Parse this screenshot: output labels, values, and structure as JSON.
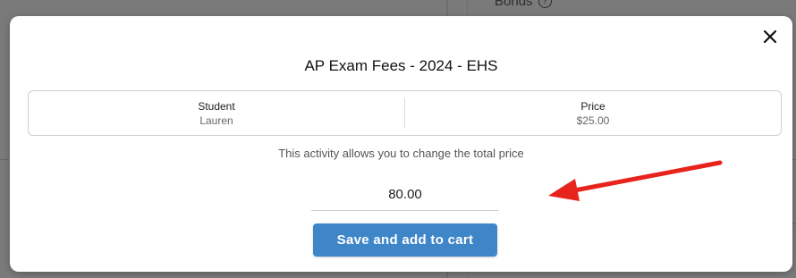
{
  "background": {
    "bonds_label": "Bonds",
    "help_icon": "question-circle-icon"
  },
  "modal": {
    "title": "AP Exam Fees - 2024 - EHS",
    "close_icon": "close-icon",
    "info": {
      "student_header": "Student",
      "student_value": "Lauren",
      "price_header": "Price",
      "price_value": "$25.00"
    },
    "hint": "This activity allows you to change the total price",
    "price_input_value": "80.00",
    "save_button_label": "Save and add to cart"
  },
  "annotation": {
    "arrow_color": "#e8231c",
    "icon": "red-arrow-annotation"
  },
  "colors": {
    "primary_button": "#3f86c8",
    "overlay": "#7a7a7a"
  }
}
